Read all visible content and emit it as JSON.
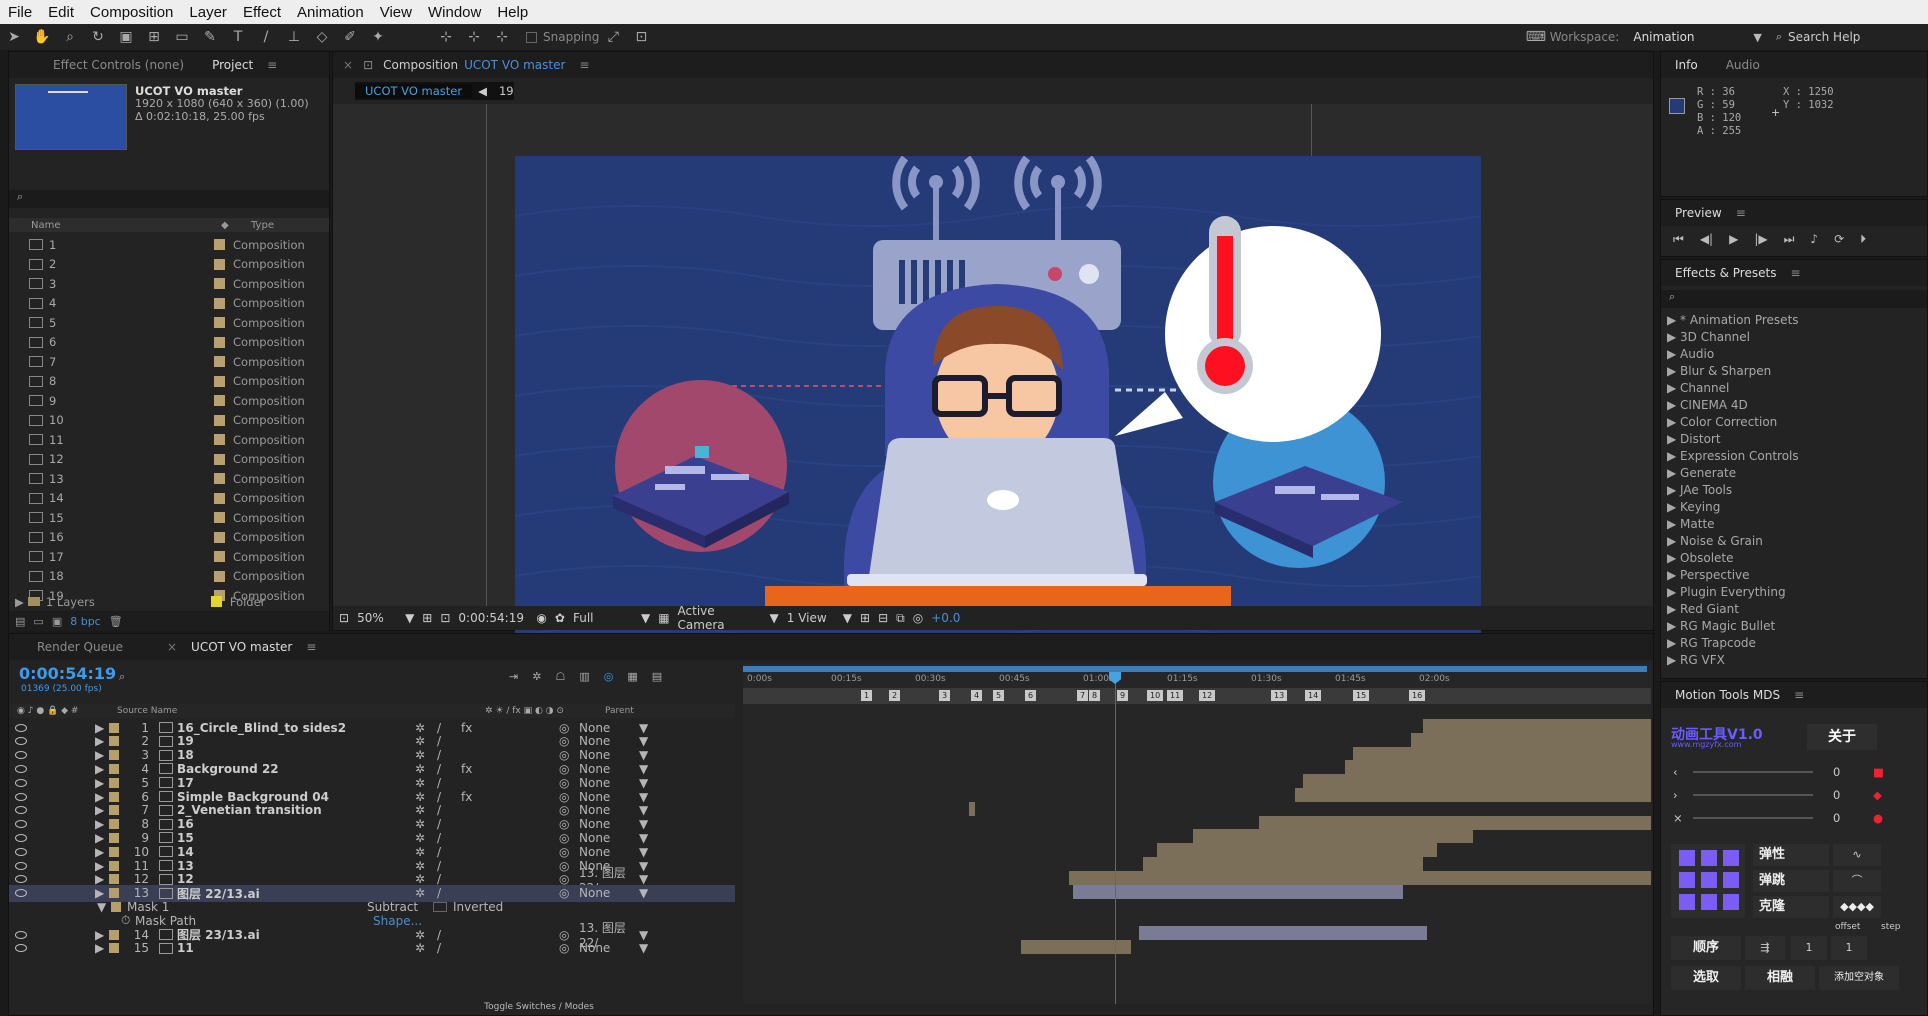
{
  "menu": [
    "File",
    "Edit",
    "Composition",
    "Layer",
    "Effect",
    "Animation",
    "View",
    "Window",
    "Help"
  ],
  "toolbar": {
    "snapping": "Snapping",
    "workspace_label": "Workspace:",
    "workspace": "Animation",
    "search_help": "Search Help"
  },
  "project": {
    "tabs": [
      "Effect Controls (none)",
      "Project"
    ],
    "comp_name": "UCOT VO master",
    "comp_size": "1920 x 1080  (640 x 360) (1.00)",
    "comp_duration": "Δ 0:02:10:18, 25.00 fps",
    "col_name": "Name",
    "col_type": "Type",
    "items": [
      "1",
      "2",
      "3",
      "4",
      "5",
      "6",
      "7",
      "8",
      "9",
      "10",
      "11",
      "12",
      "13",
      "14",
      "15",
      "16",
      "17",
      "18",
      "19"
    ],
    "item_type": "Composition",
    "folder_name": "1 Layers",
    "folder_type": "Folder",
    "bpc": "8 bpc"
  },
  "comp": {
    "tab_prefix": "Composition",
    "tab_name": "UCOT VO master",
    "crumb": "UCOT VO master",
    "crumb_num": "19",
    "zoom": "50%",
    "timecode": "0:00:54:19",
    "resolution": "Full",
    "camera": "Active Camera",
    "views": "1 View",
    "exposure": "+0.0"
  },
  "info": {
    "tabs": [
      "Info",
      "Audio"
    ],
    "r": "R : 36",
    "g": "G : 59",
    "b": "B : 120",
    "a": "A : 255",
    "x": "X : 1250",
    "y": "Y : 1032",
    "swatch": "#243b78"
  },
  "preview": {
    "title": "Preview"
  },
  "effects": {
    "title": "Effects & Presets",
    "items": [
      "* Animation Presets",
      "3D Channel",
      "Audio",
      "Blur & Sharpen",
      "Channel",
      "CINEMA 4D",
      "Color Correction",
      "Distort",
      "Expression Controls",
      "Generate",
      "JAe Tools",
      "Keying",
      "Matte",
      "Noise & Grain",
      "Obsolete",
      "Perspective",
      "Plugin Everything",
      "Red Giant",
      "RG Magic Bullet",
      "RG Trapcode",
      "RG VFX"
    ]
  },
  "motion": {
    "title": "Motion Tools MDS",
    "brand": "动画工具V1.0",
    "brand_url": "www.mgzyfx.com",
    "about": "关于",
    "values": [
      "0",
      "0",
      "0"
    ],
    "elastic": "弹性",
    "bounce": "弹跳",
    "clone": "克隆",
    "offset": "offset",
    "step": "step",
    "order": "顺序",
    "offset_val": "1",
    "step_val": "1",
    "select": "选取",
    "align": "相融",
    "add_null": "添加空对象"
  },
  "timeline": {
    "tabs": [
      "Render Queue",
      "UCOT VO master"
    ],
    "timecode": "0:00:54:19",
    "frames": "01369 (25.00 fps)",
    "col_source": "Source Name",
    "col_parent": "Parent",
    "ruler": [
      "0:00s",
      "00:15s",
      "00:30s",
      "00:45s",
      "01:00s",
      "01:15s",
      "01:30s",
      "01:45s",
      "02:00s"
    ],
    "markers": [
      "1",
      "2",
      "3",
      "4",
      "5",
      "6",
      "7",
      "8",
      "9",
      "10",
      "11",
      "12",
      "13",
      "14",
      "15",
      "16"
    ],
    "toggle": "Toggle Switches / Modes",
    "layers": [
      {
        "num": "1",
        "name": "16_Circle_Blind_to sides2",
        "fx": "fx",
        "parent": "None"
      },
      {
        "num": "2",
        "name": "19",
        "fx": "",
        "parent": "None"
      },
      {
        "num": "3",
        "name": "18",
        "fx": "",
        "parent": "None"
      },
      {
        "num": "4",
        "name": "Background 22",
        "fx": "fx",
        "parent": "None"
      },
      {
        "num": "5",
        "name": "17",
        "fx": "",
        "parent": "None"
      },
      {
        "num": "6",
        "name": "Simple Background 04",
        "fx": "fx",
        "parent": "None"
      },
      {
        "num": "7",
        "name": "2_Venetian transition",
        "fx": "",
        "parent": "None"
      },
      {
        "num": "8",
        "name": "16",
        "fx": "",
        "parent": "None"
      },
      {
        "num": "9",
        "name": "15",
        "fx": "",
        "parent": "None"
      },
      {
        "num": "10",
        "name": "14",
        "fx": "",
        "parent": "None"
      },
      {
        "num": "11",
        "name": "13",
        "fx": "",
        "parent": "None"
      },
      {
        "num": "12",
        "name": "12",
        "fx": "",
        "parent": "13. 图层 22/"
      },
      {
        "num": "13",
        "name": "图层 22/13.ai",
        "fx": "",
        "parent": "None"
      }
    ],
    "mask": "Mask 1",
    "mask_mode": "Subtract",
    "mask_inverted": "Inverted",
    "mask_path": "Mask Path",
    "mask_shape": "Shape...",
    "layers2": [
      {
        "num": "14",
        "name": "图层 23/13.ai",
        "parent": "13. 图层 22/"
      },
      {
        "num": "15",
        "name": "11",
        "parent": "None"
      }
    ]
  }
}
